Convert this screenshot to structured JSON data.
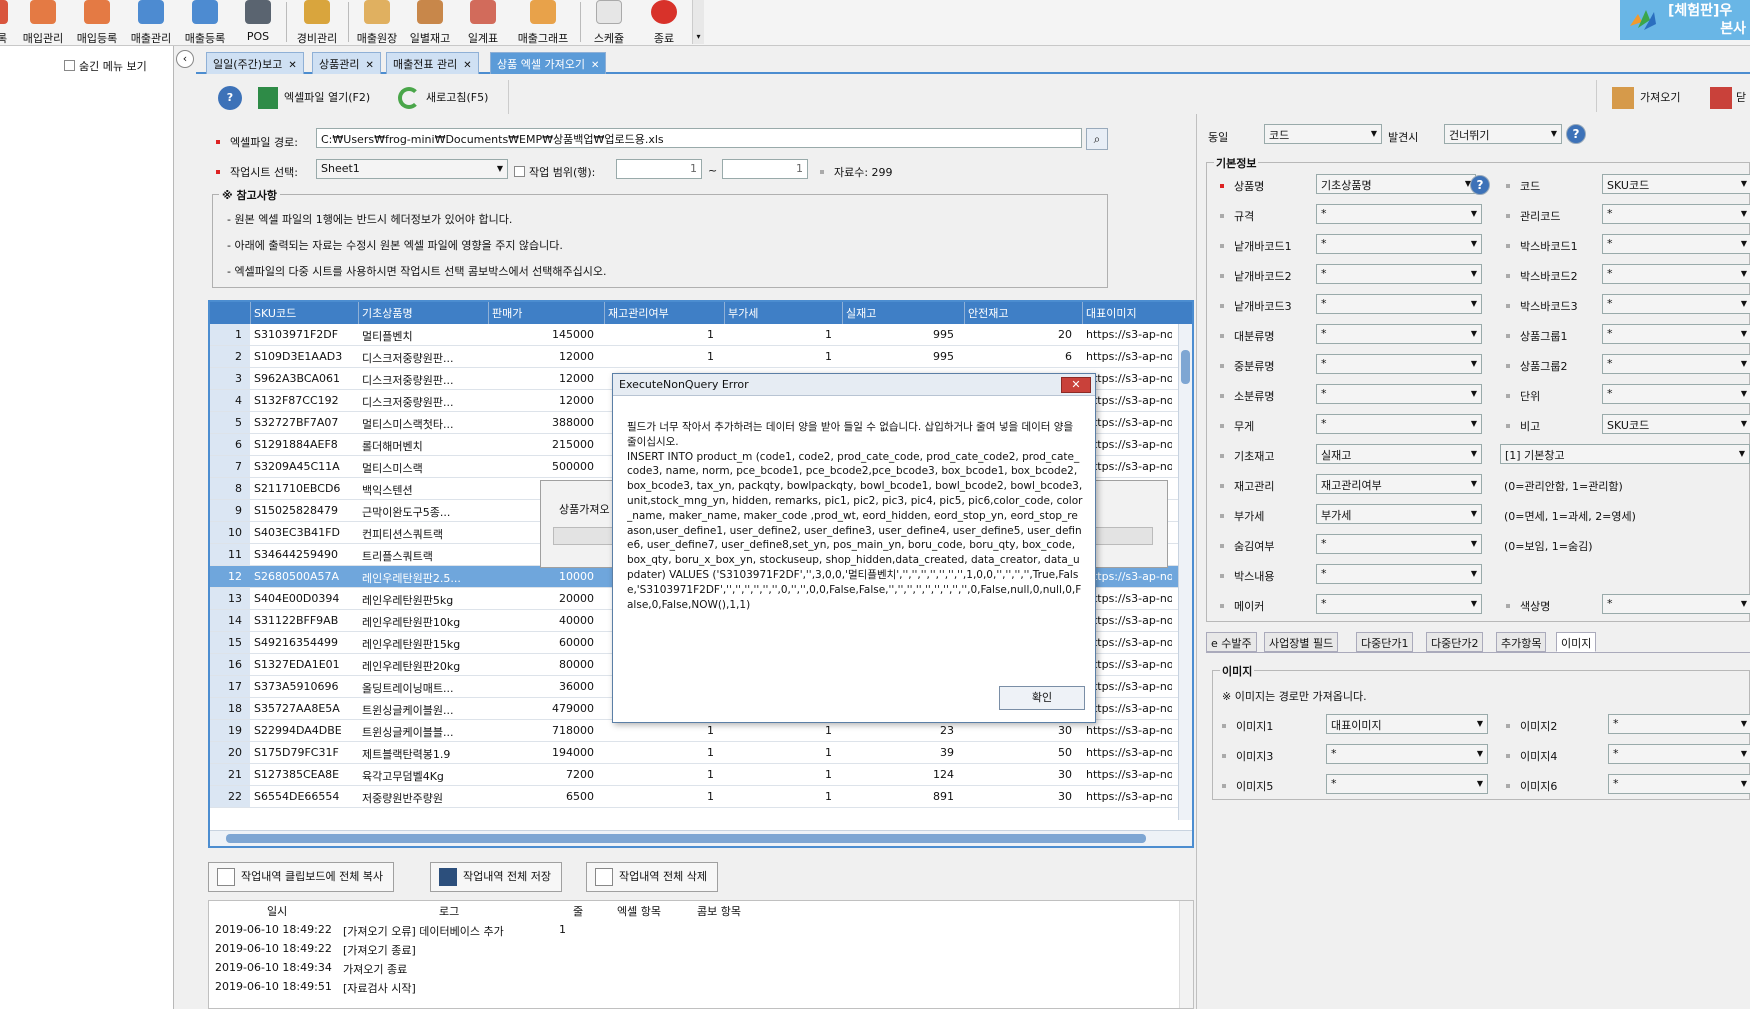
{
  "toolbar": {
    "items": [
      {
        "label": "록"
      },
      {
        "label": "매입관리"
      },
      {
        "label": "매입등록"
      },
      {
        "label": "매출관리"
      },
      {
        "label": "매출등록"
      },
      {
        "label": "POS"
      },
      {
        "label": "경비관리"
      },
      {
        "label": "매출원장"
      },
      {
        "label": "일별재고"
      },
      {
        "label": "일계표"
      },
      {
        "label": "매출그래프"
      },
      {
        "label": "스케쥴"
      },
      {
        "label": "종료"
      }
    ],
    "brand_line1": "[체험판]우",
    "brand_line2": "본사"
  },
  "left_panel": {
    "hide_menu_label": "숨긴 메뉴 보기"
  },
  "tabs": [
    {
      "label": "일일(주간)보고"
    },
    {
      "label": "상품관리"
    },
    {
      "label": "매출전표 관리"
    },
    {
      "label": "상품 엑셀 가져오기"
    }
  ],
  "actions": {
    "open_excel": "엑셀파일 열기(F2)",
    "refresh": "새로고침(F5)",
    "import": "가져오기",
    "close_short": "닫"
  },
  "form": {
    "path_label": "엑셀파일 경로:",
    "path_value": "C:₩Users₩frog-mini₩Documents₩EMP₩상품백업₩업로드용.xls",
    "sheet_label": "작업시트 선택:",
    "sheet_value": "Sheet1",
    "range_label": "작업 범위(행):",
    "range_from": "1",
    "range_to": "1",
    "tilde": "~",
    "count_label": "자료수: 299"
  },
  "notes": {
    "title": "※ 참고사항",
    "lines": [
      "- 원본 엑셀 파일의 1행에는 반드시 헤더정보가 있어야 합니다.",
      "- 아래에 출력되는 자료는 수정시 원본 엑셀 파일에 영향을 주지 않습니다.",
      "- 엑셀파일의 다중 시트를 사용하시면 작업시트 선택 콤보박스에서 선택해주십시오."
    ]
  },
  "grid": {
    "columns": [
      "SKU코드",
      "기초상품명",
      "판매가",
      "재고관리여부",
      "부가세",
      "실재고",
      "안전재고",
      "대표이미지"
    ],
    "rows": [
      [
        "1",
        "S3103971F2DF",
        "멀티플벤치",
        "145000",
        "1",
        "1",
        "995",
        "20",
        "https://s3-ap-no"
      ],
      [
        "2",
        "S109D3E1AAD3",
        "디스크저중량원판...",
        "12000",
        "1",
        "1",
        "995",
        "6",
        "https://s3-ap-no"
      ],
      [
        "3",
        "S962A3BCA061",
        "디스크저중량원판...",
        "12000",
        "",
        "",
        "",
        "",
        "https://s3-ap-no"
      ],
      [
        "4",
        "S132F87CC192",
        "디스크저중량원판...",
        "12000",
        "",
        "",
        "",
        "",
        "https://s3-ap-no"
      ],
      [
        "5",
        "S32727BF7A07",
        "멀티스미스랙첫타...",
        "388000",
        "",
        "",
        "",
        "",
        "https://s3-ap-no"
      ],
      [
        "6",
        "S1291884AEF8",
        "롤더해머벤치",
        "215000",
        "",
        "",
        "",
        "",
        "https://s3-ap-no"
      ],
      [
        "7",
        "S3209A45C11A",
        "멀티스미스랙",
        "500000",
        "",
        "",
        "",
        "",
        "https://s3-ap-no"
      ],
      [
        "8",
        "S211710EBCD6",
        "백익스텐션",
        "",
        "",
        "",
        "",
        "",
        "no"
      ],
      [
        "9",
        "S15025828479",
        "근막이완도구5종...",
        "",
        "",
        "",
        "",
        "",
        "no"
      ],
      [
        "10",
        "S403EC3B41FD",
        "컨피티션스쿼트랙",
        "",
        "",
        "",
        "",
        "",
        "no"
      ],
      [
        "11",
        "S34644259490",
        "트리플스쿼트랙",
        "",
        "",
        "",
        "",
        "",
        "no"
      ],
      [
        "12",
        "S2680500A57A",
        "레인우레탄원판2.5...",
        "10000",
        "",
        "",
        "",
        "",
        "https://s3-ap-no"
      ],
      [
        "13",
        "S404E00D0394",
        "레인우레탄원판5kg",
        "20000",
        "",
        "",
        "",
        "",
        "https://s3-ap-no"
      ],
      [
        "14",
        "S31122BFF9AB",
        "레인우레탄원판10kg",
        "40000",
        "",
        "",
        "",
        "",
        "https://s3-ap-no"
      ],
      [
        "15",
        "S49216354499",
        "레인우레탄원판15kg",
        "60000",
        "",
        "",
        "",
        "",
        "https://s3-ap-no"
      ],
      [
        "16",
        "S1327EDA1E01",
        "레인우레탄원판20kg",
        "80000",
        "",
        "",
        "",
        "",
        "https://s3-ap-no"
      ],
      [
        "17",
        "S373A5910696",
        "올딩트레이닝매트...",
        "36000",
        "",
        "",
        "",
        "",
        "https://s3-ap-no"
      ],
      [
        "18",
        "S35727AA8E5A",
        "트윈싱글케이블원...",
        "479000",
        "",
        "",
        "",
        "",
        "https://s3-ap-no"
      ],
      [
        "19",
        "S22994DA4DBE",
        "트윈싱글케이블블...",
        "718000",
        "1",
        "1",
        "23",
        "30",
        "https://s3-ap-no"
      ],
      [
        "20",
        "S175D79FC31F",
        "제트블랙탄력봉1.9",
        "194000",
        "1",
        "1",
        "39",
        "50",
        "https://s3-ap-no"
      ],
      [
        "21",
        "S127385CEA8E",
        "육각고무덤벨4Kg",
        "7200",
        "1",
        "1",
        "124",
        "30",
        "https://s3-ap-no"
      ],
      [
        "22",
        "S6554DE66554",
        "저중량원반주량원",
        "6500",
        "1",
        "1",
        "891",
        "30",
        "https://s3-ap-no"
      ]
    ]
  },
  "error_dialog": {
    "title": "ExecuteNonQuery Error",
    "close_label": "✕",
    "message": "필드가 너무 작아서 추가하려는 데이터 양을 받아 들일 수 없습니다. 삽입하거나 줄여 넣을 데이터 양을 줄이십시오.\nINSERT INTO product_m (code1, code2, prod_cate_code, prod_cate_code2, prod_cate_code3, name, norm, pce_bcode1, pce_bcode2,pce_bcode3, box_bcode1, box_bcode2, box_bcode3, tax_yn, packqty, bowlpackqty, bowl_bcode1, bowl_bcode2, bowl_bcode3, unit,stock_mng_yn, hidden, remarks, pic1, pic2, pic3, pic4, pic5, pic6,color_code, color_name, maker_name, maker_code ,prod_wt, eord_hidden, eord_stop_yn, eord_stop_reason,user_define1, user_define2, user_define3, user_define4, user_define5, user_define6, user_define7, user_define8,set_yn, pos_main_yn, boru_code, boru_qty, box_code, box_qty, boru_x_box_yn, stockuseup, shop_hidden,data_created, data_creator, data_updater) VALUES ('S3103971F2DF','',3,0,0,'멀티플벤치','','','','','','','',1,0,0,'','','','',True,False,'S3103971F2DF','','','','','','',0,'','',0,0,False,False,'','','','','','','','','',0,False,null,0,null,0,False,0,False,NOW(),1,1)",
    "ok_label": "확인"
  },
  "progress_dialog": {
    "label": "상품가져오"
  },
  "log_buttons": [
    "작업내역 클립보드에 전체 복사",
    "작업내역 전체 저장",
    "작업내역 전체 삭제"
  ],
  "log": {
    "headers": [
      "일시",
      "로그",
      "줄",
      "엑셀 항목",
      "콤보 항목"
    ],
    "rows": [
      {
        "time": "2019-06-10 18:49:22",
        "msg": "[가져오기 오류] 데이터베이스 추가",
        "line": "1"
      },
      {
        "time": "2019-06-10 18:49:22",
        "msg": "[가져오기 종료]",
        "line": ""
      },
      {
        "time": "2019-06-10 18:49:34",
        "msg": "가져오기 종료",
        "line": ""
      },
      {
        "time": "2019-06-10 18:49:51",
        "msg": "[자료검사 시작]",
        "line": ""
      }
    ]
  },
  "right": {
    "same_label": "동일",
    "same_value": "코드",
    "found_label": "발견시",
    "found_value": "건너뛰기",
    "basic_title": "기본정보",
    "fields_left": [
      {
        "label": "상품명",
        "value": "기초상품명",
        "required": true
      },
      {
        "label": "규격",
        "value": "*"
      },
      {
        "label": "낱개바코드1",
        "value": "*"
      },
      {
        "label": "낱개바코드2",
        "value": "*"
      },
      {
        "label": "낱개바코드3",
        "value": "*"
      },
      {
        "label": "대분류명",
        "value": "*"
      },
      {
        "label": "중분류명",
        "value": "*"
      },
      {
        "label": "소분류명",
        "value": "*"
      },
      {
        "label": "무게",
        "value": "*"
      },
      {
        "label": "기초재고",
        "value": "실재고"
      },
      {
        "label": "재고관리",
        "value": "재고관리여부"
      },
      {
        "label": "부가세",
        "value": "부가세"
      },
      {
        "label": "숨김여부",
        "value": "*"
      },
      {
        "label": "박스내용",
        "value": "*"
      },
      {
        "label": "메이커",
        "value": "*"
      }
    ],
    "fields_right": [
      {
        "label": "코드",
        "value": "SKU코드"
      },
      {
        "label": "관리코드",
        "value": "*"
      },
      {
        "label": "박스바코드1",
        "value": "*"
      },
      {
        "label": "박스바코드2",
        "value": "*"
      },
      {
        "label": "박스바코드3",
        "value": "*"
      },
      {
        "label": "상품그룹1",
        "value": "*"
      },
      {
        "label": "상품그룹2",
        "value": "*"
      },
      {
        "label": "단위",
        "value": "*"
      },
      {
        "label": "비고",
        "value": "SKU코드"
      },
      {
        "label": "",
        "value": "[1] 기본창고"
      },
      {
        "label": "",
        "value": "(0=관리안함, 1=관리함)"
      },
      {
        "label": "",
        "value": "(0=면세, 1=과세, 2=영세)"
      },
      {
        "label": "",
        "value": "(0=보임, 1=숨김)"
      },
      {
        "label": "색상명",
        "value": "*"
      }
    ],
    "sub_tabs": [
      "e 수발주",
      "사업장별 필드",
      "다중단가1",
      "다중단가2",
      "추가항목",
      "이미지"
    ],
    "image_title": "이미지",
    "image_note": "※ 이미지는 경로만 가져옵니다.",
    "image_fields": [
      {
        "label": "이미지1",
        "value": "대표이미지"
      },
      {
        "label": "이미지2",
        "value": "*"
      },
      {
        "label": "이미지3",
        "value": "*"
      },
      {
        "label": "이미지4",
        "value": "*"
      },
      {
        "label": "이미지5",
        "value": "*"
      },
      {
        "label": "이미지6",
        "value": "*"
      }
    ]
  },
  "colors": {
    "accent": "#4c8dd0",
    "header": "#3f7fc6",
    "selected": "#6fa6dc",
    "close": "#c9413a"
  }
}
